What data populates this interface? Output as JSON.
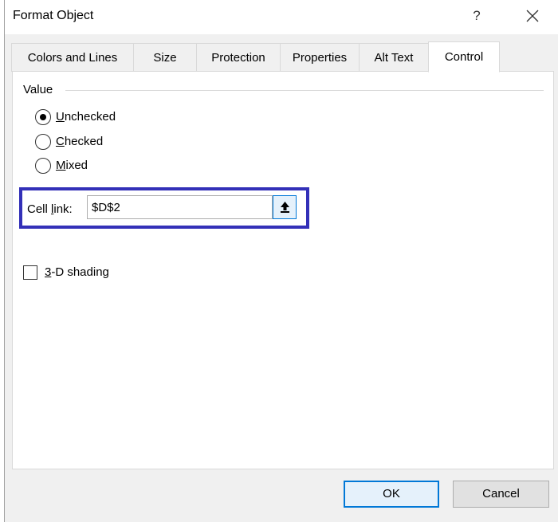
{
  "window": {
    "title": "Format Object",
    "help_label": "?"
  },
  "tabs": [
    {
      "label": "Colors and Lines",
      "active": false
    },
    {
      "label": "Size",
      "active": false
    },
    {
      "label": "Protection",
      "active": false
    },
    {
      "label": "Properties",
      "active": false
    },
    {
      "label": "Alt Text",
      "active": false
    },
    {
      "label": "Control",
      "active": true
    }
  ],
  "value_group": {
    "label": "Value",
    "options": [
      {
        "prefix": "",
        "accel": "U",
        "rest": "nchecked",
        "selected": true
      },
      {
        "prefix": "",
        "accel": "C",
        "rest": "hecked",
        "selected": false
      },
      {
        "prefix": "",
        "accel": "M",
        "rest": "ixed",
        "selected": false
      }
    ]
  },
  "cell_link": {
    "label_pre": "Cell ",
    "label_accel": "l",
    "label_post": "ink:",
    "value": "$D$2",
    "highlight_color": "#3330b8"
  },
  "shading": {
    "accel": "3",
    "rest": "-D shading",
    "checked": false
  },
  "buttons": {
    "ok": "OK",
    "cancel": "Cancel"
  },
  "colors": {
    "accent": "#0078d7",
    "dialog_bg": "#f0f0f0"
  }
}
